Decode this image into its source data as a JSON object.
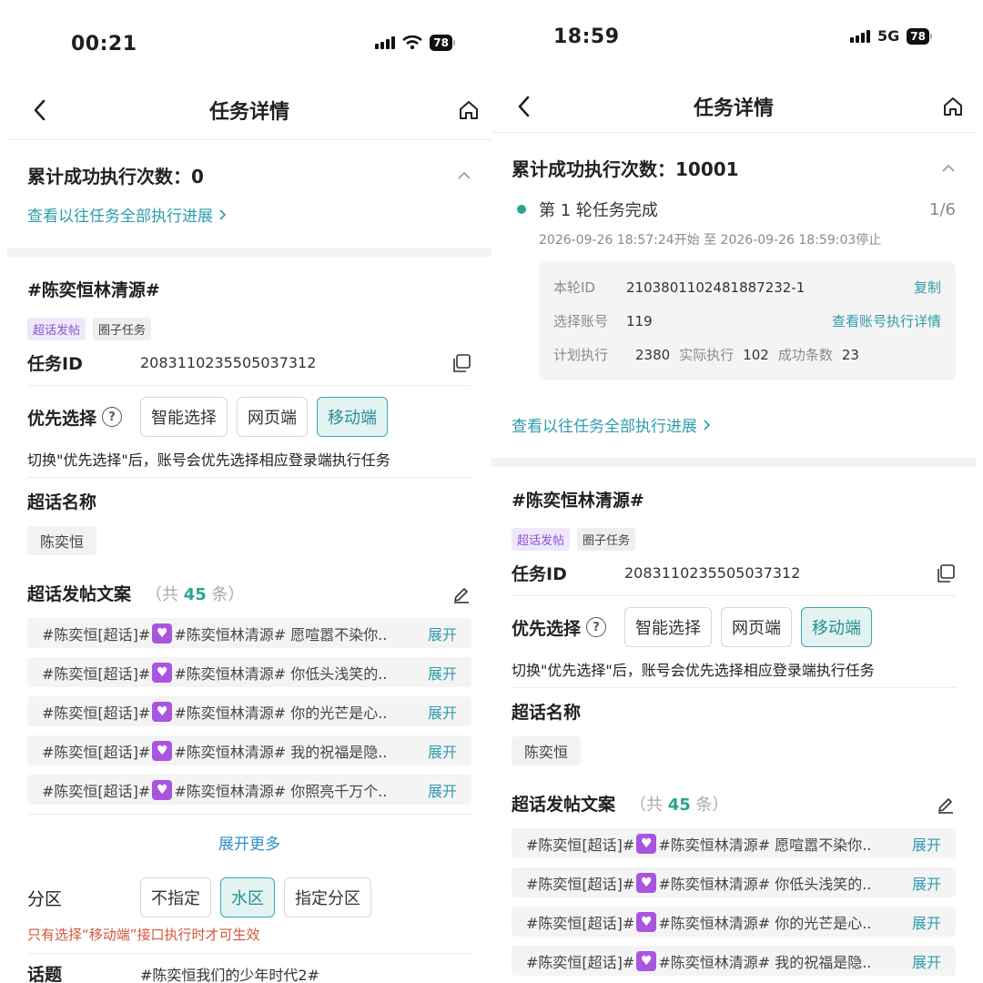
{
  "left": {
    "status": {
      "time": "00:21",
      "battery": "78"
    },
    "nav": {
      "title": "任务详情"
    },
    "exec_label": "累计成功执行次数：",
    "exec_count": "0",
    "progress_link": "查看以往任务全部执行进展",
    "topic_title": "#陈奕恒林清源#",
    "tags": [
      "超话发帖",
      "圈子任务"
    ],
    "task_id_label": "任务ID",
    "task_id": "2083110235505037312",
    "prio_label": "优先选择",
    "prio_options": [
      "智能选择",
      "网页端",
      "移动端"
    ],
    "prio_hint": "切换\"优先选择\"后，账号会优先选择相应登录端执行任务",
    "supertopic_label": "超话名称",
    "supertopic_name": "陈奕恒",
    "copy_label": "超话发帖文案",
    "copy_count_prefix": "（共",
    "copy_count": "45",
    "copy_count_suffix": "条）",
    "posts": [
      {
        "pre": "#陈奕恒[超话]#",
        "post": "#陈奕恒林清源# 愿喧嚣不染你..",
        "action": "展开"
      },
      {
        "pre": "#陈奕恒[超话]#",
        "post": "#陈奕恒林清源# 你低头浅笑的..",
        "action": "展开"
      },
      {
        "pre": "#陈奕恒[超话]#",
        "post": "#陈奕恒林清源# 你的光芒是心..",
        "action": "展开"
      },
      {
        "pre": "#陈奕恒[超话]#",
        "post": "#陈奕恒林清源# 我的祝福是隐..",
        "action": "展开"
      },
      {
        "pre": "#陈奕恒[超话]#",
        "post": "#陈奕恒林清源# 你照亮千万个..",
        "action": "展开"
      }
    ],
    "expand_more": "展开更多",
    "zone_label": "分区",
    "zone_options": [
      "不指定",
      "水区",
      "指定分区"
    ],
    "zone_warn": "只有选择“移动端”接口执行时才可生效",
    "topic_label": "话题",
    "topic_value": "#陈奕恒我们的少年时代2#"
  },
  "right": {
    "status": {
      "time": "18:59",
      "network": "5G",
      "battery": "78"
    },
    "nav": {
      "title": "任务详情"
    },
    "exec_label": "累计成功执行次数：",
    "exec_count": "10001",
    "round": {
      "title": "第 1 轮任务完成",
      "fraction": "1/6",
      "time": "2026-09-26 18:57:24开始 至 2026-09-26 18:59:03停止",
      "round_id_label": "本轮ID",
      "round_id": "2103801102481887232-1",
      "copy_action": "复制",
      "account_label": "选择账号",
      "account_count": "119",
      "account_link": "查看账号执行详情",
      "plan_label": "计划执行",
      "plan_value": "2380",
      "actual_label": "实际执行",
      "actual_value": "102",
      "success_label": "成功条数",
      "success_value": "23"
    },
    "progress_link": "查看以往任务全部执行进展",
    "topic_title": "#陈奕恒林清源#",
    "tags": [
      "超话发帖",
      "圈子任务"
    ],
    "task_id_label": "任务ID",
    "task_id": "2083110235505037312",
    "prio_label": "优先选择",
    "prio_options": [
      "智能选择",
      "网页端",
      "移动端"
    ],
    "prio_hint": "切换\"优先选择\"后，账号会优先选择相应登录端执行任务",
    "supertopic_label": "超话名称",
    "supertopic_name": "陈奕恒",
    "copy_label": "超话发帖文案",
    "copy_count_prefix": "（共",
    "copy_count": "45",
    "copy_count_suffix": "条）",
    "posts": [
      {
        "pre": "#陈奕恒[超话]#",
        "post": "#陈奕恒林清源# 愿喧嚣不染你..",
        "action": "展开"
      },
      {
        "pre": "#陈奕恒[超话]#",
        "post": "#陈奕恒林清源# 你低头浅笑的..",
        "action": "展开"
      },
      {
        "pre": "#陈奕恒[超话]#",
        "post": "#陈奕恒林清源# 你的光芒是心..",
        "action": "展开"
      },
      {
        "pre": "#陈奕恒[超话]#",
        "post": "#陈奕恒林清源# 我的祝福是隐..",
        "action": "展开"
      }
    ]
  },
  "colors": {
    "accent": "#2aa58f",
    "link": "#2e9bad",
    "warn": "#d2563b",
    "tag_purple": "#8a55d6",
    "heart": "#a955e0"
  },
  "icons": {
    "back": "chevron-left-icon",
    "home": "home-icon",
    "copy": "copy-icon",
    "edit": "edit-icon",
    "help": "question-icon",
    "collapse": "chevron-up-icon"
  }
}
